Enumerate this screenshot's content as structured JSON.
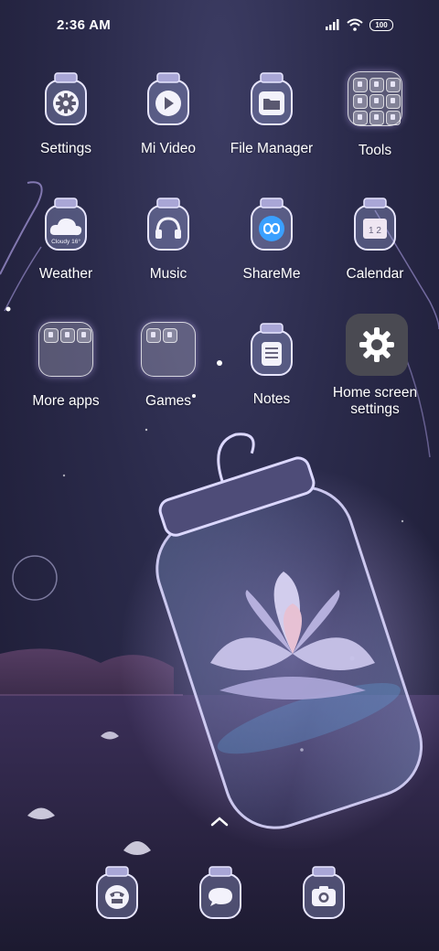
{
  "status_bar": {
    "time": "2:36 AM",
    "battery_level": "100"
  },
  "apps": [
    {
      "label": "Settings",
      "icon": "gear-icon"
    },
    {
      "label": "Mi Video",
      "icon": "play-icon"
    },
    {
      "label": "File Manager",
      "icon": "folder-icon"
    },
    {
      "label": "Tools",
      "icon": "folder-grid"
    },
    {
      "label": "Weather",
      "icon": "cloud-icon",
      "badge": "Cloudy 16°"
    },
    {
      "label": "Music",
      "icon": "headphones-icon"
    },
    {
      "label": "ShareMe",
      "icon": "infinity-icon"
    },
    {
      "label": "Calendar",
      "icon": "calendar-icon",
      "badge": "1 2"
    },
    {
      "label": "More apps",
      "icon": "folder-grid"
    },
    {
      "label": "Games",
      "icon": "folder-grid"
    },
    {
      "label": "Notes",
      "icon": "notes-icon"
    },
    {
      "label": "Home screen settings",
      "icon": "gear-icon"
    }
  ],
  "dock": [
    {
      "name": "Phone",
      "icon": "phone-icon"
    },
    {
      "name": "Messaging",
      "icon": "message-icon"
    },
    {
      "name": "Camera",
      "icon": "camera-icon"
    }
  ],
  "colors": {
    "background": "#2a2a4a",
    "jar_glow": "#b99cff",
    "accent_blue": "#3aa0ff"
  }
}
